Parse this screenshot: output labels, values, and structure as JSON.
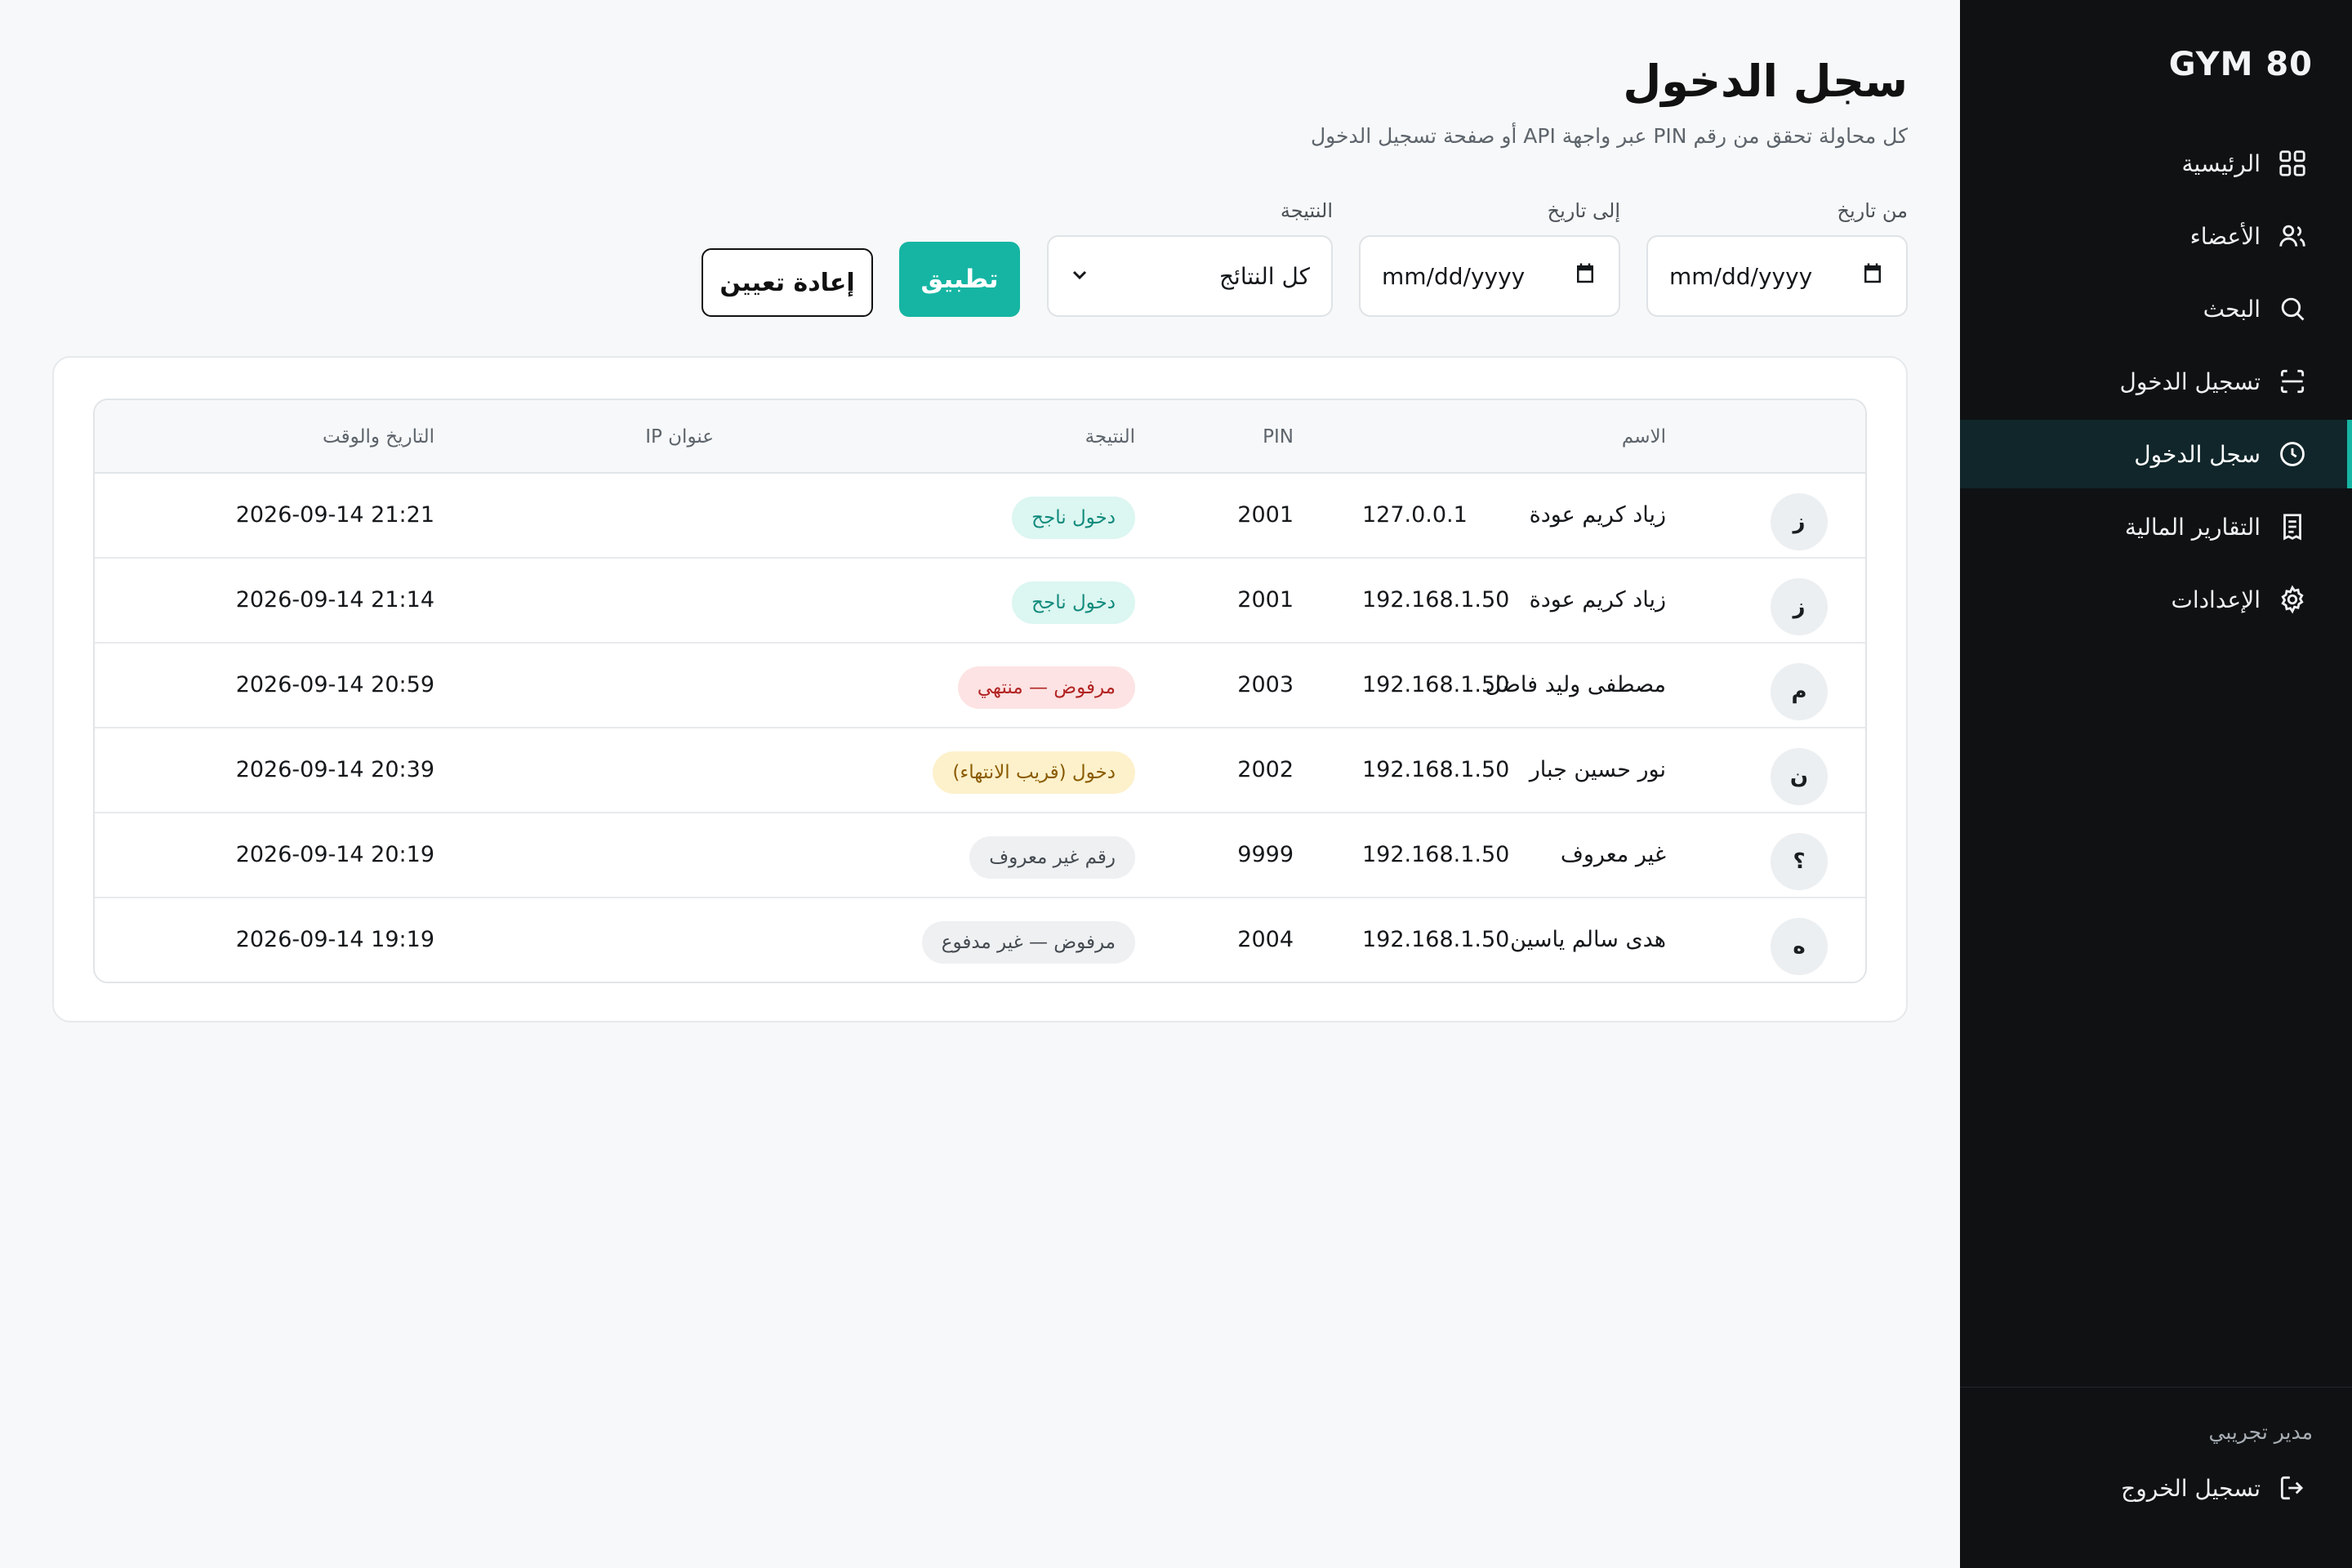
{
  "sidebar": {
    "brand": "GYM 80",
    "items": [
      {
        "label": "الرئيسية",
        "icon": "grid-icon"
      },
      {
        "label": "الأعضاء",
        "icon": "users-icon"
      },
      {
        "label": "البحث",
        "icon": "search-icon"
      },
      {
        "label": "تسجيل الدخول",
        "icon": "scan-icon"
      },
      {
        "label": "سجل الدخول",
        "icon": "clock-icon",
        "active": true
      },
      {
        "label": "التقارير المالية",
        "icon": "receipt-icon"
      },
      {
        "label": "الإعدادات",
        "icon": "gear-icon"
      }
    ],
    "user_name": "مدير تجريبي",
    "logout_label": "تسجيل الخروج"
  },
  "header": {
    "title": "سجل الدخول",
    "subtitle": "كل محاولة تحقق من رقم PIN عبر واجهة API أو صفحة تسجيل الدخول"
  },
  "filters": {
    "from_label": "من تاريخ",
    "from_value": "mm/dd/yyyy",
    "to_label": "إلى تاريخ",
    "to_value": "mm/dd/yyyy",
    "result_label": "النتيجة",
    "result_value": "كل النتائج",
    "apply_label": "تطبيق",
    "reset_label": "إعادة تعيين"
  },
  "table": {
    "headers": {
      "name": "الاسم",
      "pin": "PIN",
      "result": "النتيجة",
      "ip": "عنوان IP",
      "datetime": "التاريخ والوقت"
    },
    "rows": [
      {
        "avatar": "ز",
        "name": "زياد كريم عودة",
        "pin": "2001",
        "result": "دخول ناجح",
        "status": "success",
        "ip": "127.0.0.1",
        "datetime": "2026-09-14 21:21"
      },
      {
        "avatar": "ز",
        "name": "زياد كريم عودة",
        "pin": "2001",
        "result": "دخول ناجح",
        "status": "success",
        "ip": "192.168.1.50",
        "datetime": "2026-09-14 21:14"
      },
      {
        "avatar": "م",
        "name": "مصطفى وليد فاضل",
        "pin": "2003",
        "result": "مرفوض — منتهي",
        "status": "danger",
        "ip": "192.168.1.50",
        "datetime": "2026-09-14 20:59"
      },
      {
        "avatar": "ن",
        "name": "نور حسين جبار",
        "pin": "2002",
        "result": "دخول (قريب الانتهاء)",
        "status": "warning",
        "ip": "192.168.1.50",
        "datetime": "2026-09-14 20:39"
      },
      {
        "avatar": "؟",
        "name": "غير معروف",
        "pin": "9999",
        "result": "رقم غير معروف",
        "status": "neutral",
        "ip": "192.168.1.50",
        "datetime": "2026-09-14 20:19"
      },
      {
        "avatar": "ه",
        "name": "هدى سالم ياسين",
        "pin": "2004",
        "result": "مرفوض — غير مدفوع",
        "status": "neutral",
        "ip": "192.168.1.50",
        "datetime": "2026-09-14 19:19"
      }
    ]
  },
  "colors": {
    "accent": "#16b5a3",
    "sidebar_bg": "#0f1113",
    "page_bg": "#f7f8f9"
  }
}
